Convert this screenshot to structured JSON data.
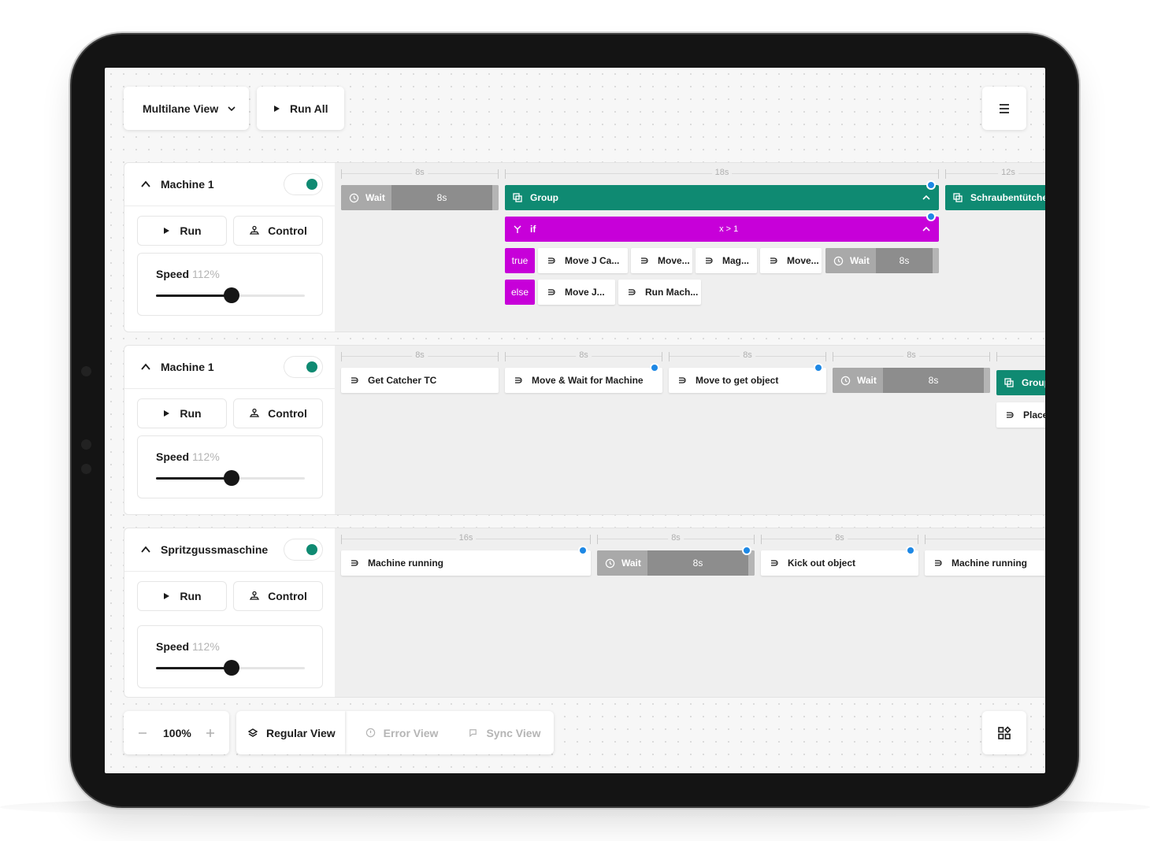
{
  "toolbar": {
    "view_select": "Multilane View",
    "run_all": "Run All"
  },
  "lanes": [
    {
      "title": "Machine 1",
      "run": "Run",
      "control": "Control",
      "speed_label": "Speed",
      "speed_value": "112%",
      "speed_fraction": 0.51,
      "ruler": [
        "8s",
        "18s",
        "12s"
      ],
      "blocks": {
        "wait": "Wait",
        "wait_time": "8s",
        "group": "Group",
        "group2": "Schraubentütchen",
        "if": "if",
        "condition": "x > 1",
        "true": "true",
        "true_items": [
          "Move J Ca...",
          "Move...",
          "Mag...",
          "Move..."
        ],
        "true_wait": "Wait",
        "true_wait_time": "8s",
        "else": "else",
        "else_items": [
          "Move J...",
          "Run Mach..."
        ]
      }
    },
    {
      "title": "Machine 1",
      "run": "Run",
      "control": "Control",
      "speed_label": "Speed",
      "speed_value": "112%",
      "speed_fraction": 0.51,
      "ruler": [
        "8s",
        "8s",
        "8s",
        "8s"
      ],
      "blocks": {
        "b1": "Get Catcher TC",
        "b2": "Move & Wait for Machine",
        "b3": "Move to get object",
        "wait": "Wait",
        "wait_time": "8s",
        "group": "Group",
        "place": "Place"
      }
    },
    {
      "title": "Spritzgussmaschine",
      "run": "Run",
      "control": "Control",
      "speed_label": "Speed",
      "speed_value": "112%",
      "speed_fraction": 0.51,
      "ruler": [
        "16s",
        "8s",
        "8s"
      ],
      "blocks": {
        "b1": "Machine running",
        "wait": "Wait",
        "wait_time": "8s",
        "b3": "Kick out object",
        "b4": "Machine running"
      }
    }
  ],
  "bottom": {
    "zoom": "100%",
    "regular_view": "Regular View",
    "error_view": "Error View",
    "sync_view": "Sync View"
  },
  "colors": {
    "accent_green": "#0f8a72",
    "condition_magenta": "#c700d9",
    "wait_gray": "#8d8d8d",
    "marker_blue": "#1e88e5"
  },
  "icons": [
    "chevron-down-icon",
    "play-icon",
    "menu-icon",
    "chevron-up-icon",
    "joystick-icon",
    "clock-icon",
    "group-icon",
    "branch-icon",
    "move-icon",
    "minus-icon",
    "plus-icon",
    "layers-icon",
    "error-icon",
    "sync-icon",
    "widgets-icon"
  ]
}
